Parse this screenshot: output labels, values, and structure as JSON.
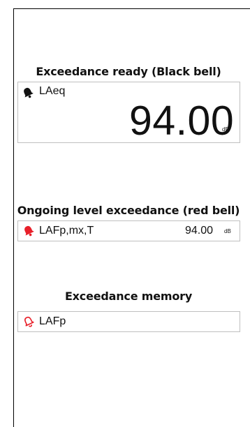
{
  "sections": [
    {
      "heading": "Exceedance ready (Black bell)",
      "bell_icon": "bell-filled-icon",
      "bell_color": "#111111",
      "label": "LAeq",
      "value": "94.00",
      "unit": "dB"
    },
    {
      "heading": "Ongoing level exceedance (red bell)",
      "bell_icon": "bell-filled-icon",
      "bell_color": "#e8202a",
      "label": "LAFp,mx,T",
      "value": "94.00",
      "unit": "dB"
    },
    {
      "heading": "Exceedance memory",
      "bell_icon": "bell-outline-icon",
      "bell_color": "#e8202a",
      "label": "LAFp"
    }
  ]
}
